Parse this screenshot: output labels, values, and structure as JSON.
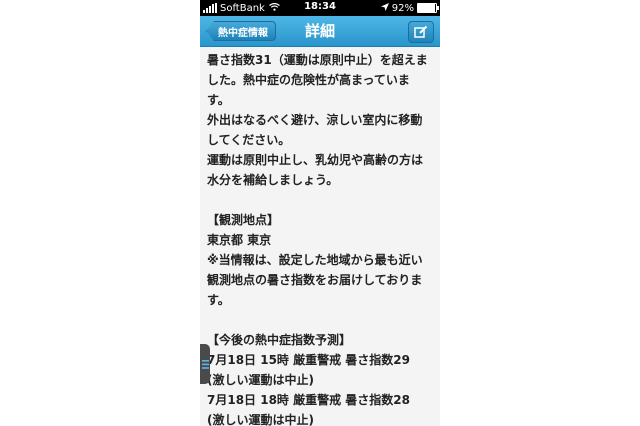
{
  "status_bar": {
    "carrier": "SoftBank",
    "time": "18:34",
    "battery": "92%",
    "battery_level": 0.92
  },
  "nav": {
    "back_label": "熱中症情報",
    "title": "詳細"
  },
  "content": {
    "lines": [
      "暑さ指数31（運動は原則中止）を超えま",
      "した。熱中症の危険性が高まっていま",
      "す。",
      "外出はなるべく避け、涼しい室内に移動",
      "してください。",
      "運動は原則中止し、乳幼児や高齢の方は",
      "水分を補給しましょう。"
    ],
    "observation_heading": "【観測地点】",
    "observation_location": "東京都 東京",
    "observation_note_lines": [
      "※当情報は、設定した地域から最も近い",
      "観測地点の暑さ指数をお届けしておりま",
      "す。"
    ],
    "forecast_heading": "【今後の熱中症指数予測】",
    "forecast": [
      {
        "line": "7月18日 15時 厳重警戒 暑さ指数29",
        "note": "(激しい運動は中止)"
      },
      {
        "line": "7月18日 18時 厳重警戒 暑さ指数28",
        "note": "(激しい運動は中止)"
      }
    ]
  }
}
